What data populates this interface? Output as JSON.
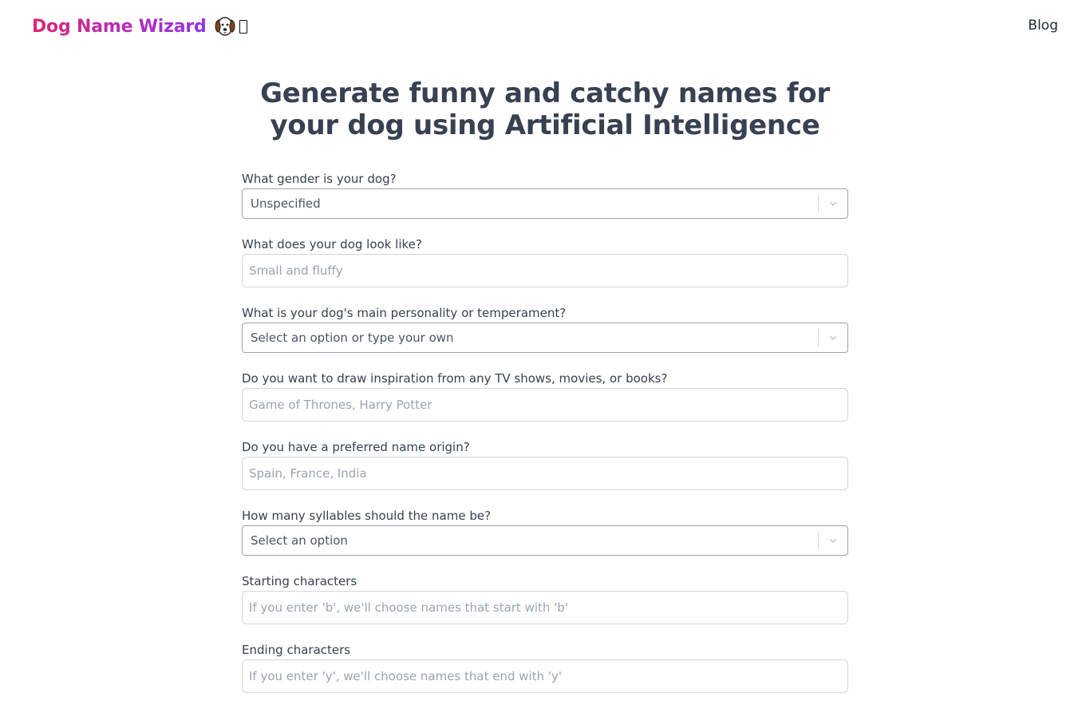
{
  "header": {
    "logo_text": "Dog Name Wizard",
    "nav_blog": "Blog"
  },
  "hero": {
    "title": "Generate funny and catchy names for your dog using Artificial Intelligence"
  },
  "form": {
    "gender": {
      "label": "What gender is your dog?",
      "value": "Unspecified"
    },
    "look": {
      "label": "What does your dog look like?",
      "placeholder": "Small and fluffy"
    },
    "personality": {
      "label": "What is your dog's main personality or temperament?",
      "value": "Select an option or type your own"
    },
    "inspiration": {
      "label": "Do you want to draw inspiration from any TV shows, movies, or books?",
      "placeholder": "Game of Thrones, Harry Potter"
    },
    "origin": {
      "label": "Do you have a preferred name origin?",
      "placeholder": "Spain, France, India"
    },
    "syllables": {
      "label": "How many syllables should the name be?",
      "value": "Select an option"
    },
    "starting": {
      "label": "Starting characters",
      "placeholder": "If you enter 'b', we'll choose names that start with 'b'"
    },
    "ending": {
      "label": "Ending characters",
      "placeholder": "If you enter 'y', we'll choose names that end with 'y'"
    }
  },
  "icons": {
    "logo": "dog-face-icon",
    "missing_glyph": "missing-glyph-icon",
    "select_indicator": "chevron-down-icon"
  }
}
